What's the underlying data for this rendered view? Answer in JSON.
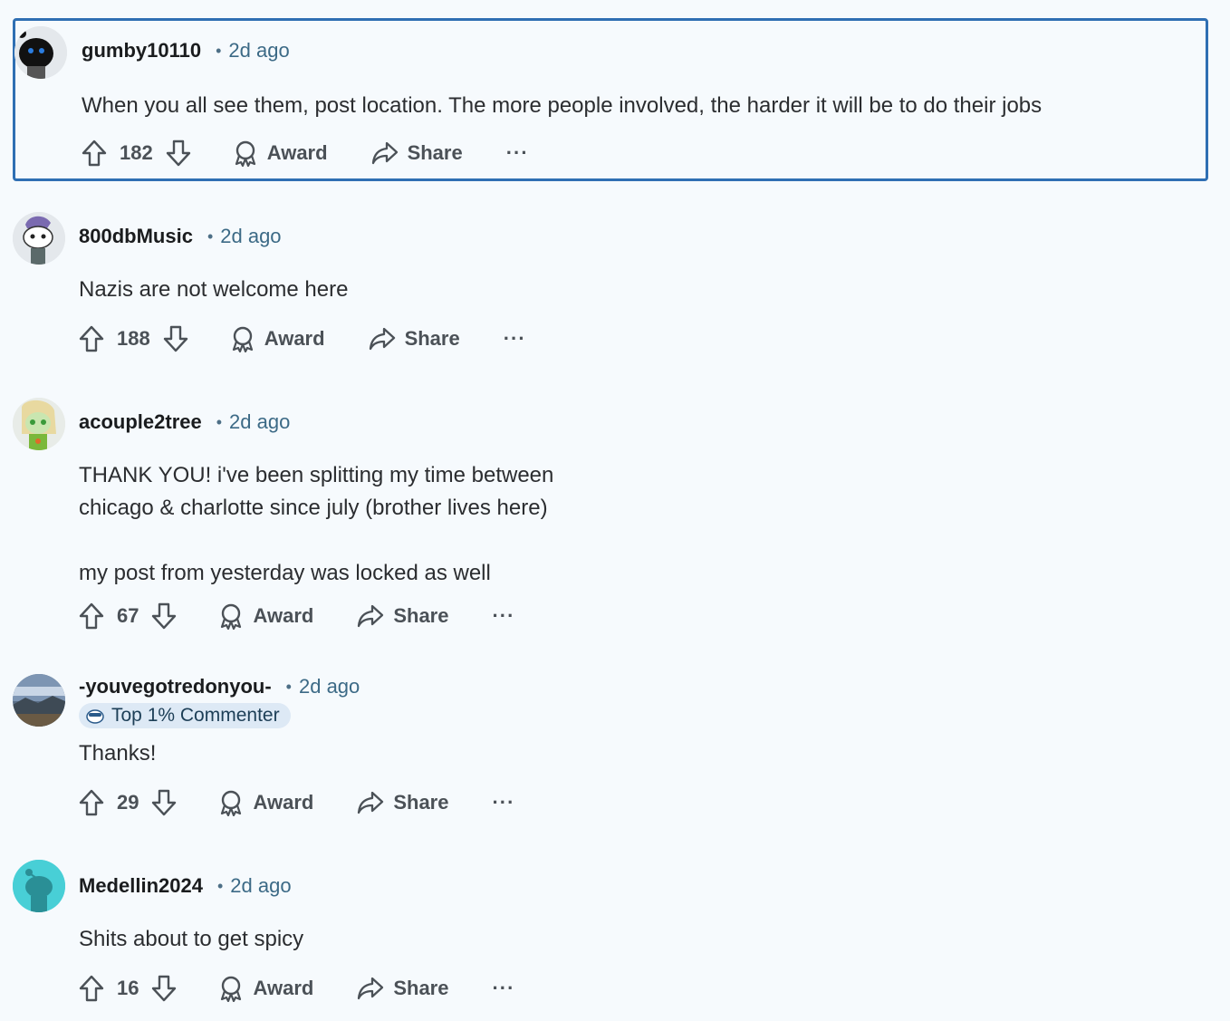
{
  "comments": [
    {
      "username": "gumby10110",
      "time": "2d ago",
      "body": "When you all see them, post location. The more people involved, the harder it will be to do their jobs",
      "votes": "182",
      "award_label": "Award",
      "share_label": "Share",
      "more_label": "···",
      "avatar_color": "#1b1b1b",
      "selected": true
    },
    {
      "username": "800dbMusic",
      "time": "2d ago",
      "body": "Nazis are not welcome here",
      "votes": "188",
      "award_label": "Award",
      "share_label": "Share",
      "more_label": "···",
      "avatar_color": "#e4e8ec"
    },
    {
      "username": "acouple2tree",
      "time": "2d ago",
      "body": "THANK YOU! i've been splitting my time between\nchicago & charlotte since july (brother lives here)\n\nmy post from yesterday was locked as well",
      "votes": "67",
      "award_label": "Award",
      "share_label": "Share",
      "more_label": "···",
      "avatar_color": "#e8ece8"
    },
    {
      "username": "-youvegotredonyou-",
      "time": "2d ago",
      "flair": "Top 1% Commenter",
      "body": "Thanks!",
      "votes": "29",
      "award_label": "Award",
      "share_label": "Share",
      "more_label": "···",
      "avatar_color": "#5a6e86"
    },
    {
      "username": "Medellin2024",
      "time": "2d ago",
      "body": "Shits about to get spicy",
      "votes": "16",
      "award_label": "Award",
      "share_label": "Share",
      "more_label": "···",
      "avatar_color": "#48cfd6"
    }
  ],
  "colors": {
    "selection_border": "#2f6fb3",
    "timestamp": "#3c6a86",
    "action_text": "#4b5157",
    "flair_bg": "#dde9f5"
  }
}
